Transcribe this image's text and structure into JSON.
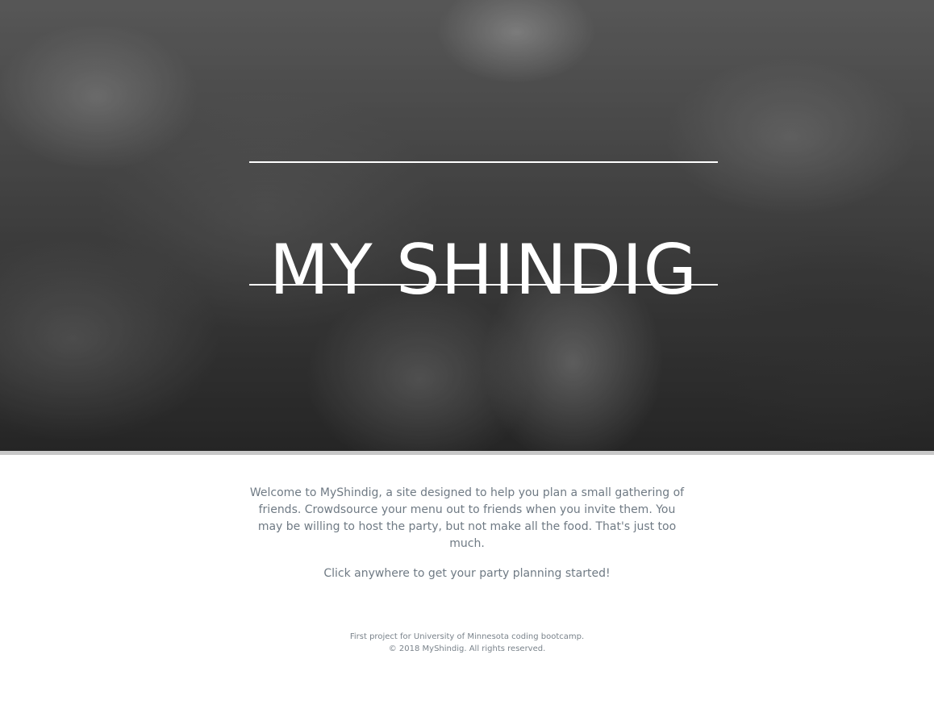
{
  "hero": {
    "title": "MY SHINDIG",
    "background_image": "outdoor-dinner-party-photo"
  },
  "main": {
    "intro": "Welcome to MyShindig, a site designed to help you plan a small gathering of friends. Crowdsource your menu out to friends when you invite them. You may be willing to host the party, but not make all the food. That's just too much.",
    "cta": "Click anywhere to get your party planning started!"
  },
  "footer": {
    "line1": "First project for University of Minnesota coding bootcamp.",
    "line2": "© 2018 MyShindig. All rights reserved."
  },
  "colors": {
    "title_text": "#ffffff",
    "body_text": "#6f7a84",
    "divider": "#c8c8c8"
  }
}
